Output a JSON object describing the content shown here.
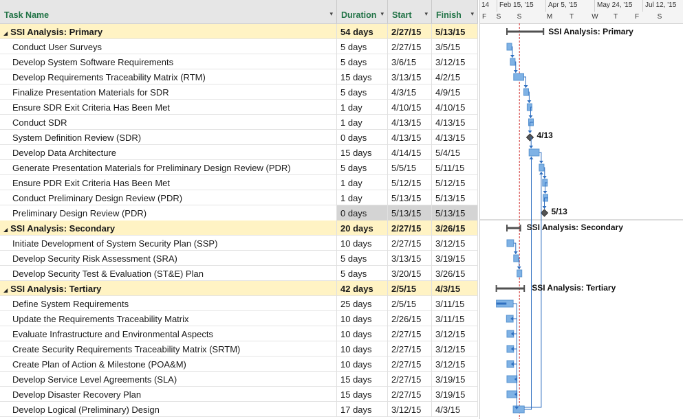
{
  "headers": {
    "task_name": "Task Name",
    "duration": "Duration",
    "start": "Start",
    "finish": "Finish"
  },
  "header_arrow": "▾",
  "summary_arrow": "◢",
  "timescale": {
    "top": [
      "14",
      "Feb 15, '15",
      "Apr 5, '15",
      "May 24, '15",
      "Jul 12, '15"
    ],
    "bottom": [
      "F",
      "S",
      "S",
      "M",
      "T",
      "W",
      "T",
      "F",
      "S"
    ]
  },
  "tasks": [
    {
      "name": "SSI Analysis: Primary",
      "duration": "54 days",
      "start": "2/27/15",
      "finish": "5/13/15",
      "summary": true
    },
    {
      "name": "Conduct User Surveys",
      "duration": "5 days",
      "start": "2/27/15",
      "finish": "3/5/15"
    },
    {
      "name": "Develop System Software Requirements",
      "duration": "5 days",
      "start": "3/6/15",
      "finish": "3/12/15"
    },
    {
      "name": "Develop Requirements Traceability Matrix (RTM)",
      "duration": "15 days",
      "start": "3/13/15",
      "finish": "4/2/15"
    },
    {
      "name": "Finalize Presentation Materials for SDR",
      "duration": "5 days",
      "start": "4/3/15",
      "finish": "4/9/15"
    },
    {
      "name": "Ensure SDR Exit Criteria Has Been Met",
      "duration": "1 day",
      "start": "4/10/15",
      "finish": "4/10/15"
    },
    {
      "name": "Conduct SDR",
      "duration": "1 day",
      "start": "4/13/15",
      "finish": "4/13/15"
    },
    {
      "name": "System Definition Review (SDR)",
      "duration": "0 days",
      "start": "4/13/15",
      "finish": "4/13/15"
    },
    {
      "name": "Develop Data Architecture",
      "duration": "15 days",
      "start": "4/14/15",
      "finish": "5/4/15"
    },
    {
      "name": "Generate Presentation Materials for Preliminary Design Review (PDR)",
      "duration": "5 days",
      "start": "5/5/15",
      "finish": "5/11/15"
    },
    {
      "name": "Ensure PDR Exit Criteria Has Been Met",
      "duration": "1 day",
      "start": "5/12/15",
      "finish": "5/12/15"
    },
    {
      "name": "Conduct Preliminary Design Review (PDR)",
      "duration": "1 day",
      "start": "5/13/15",
      "finish": "5/13/15"
    },
    {
      "name": "Preliminary Design Review (PDR)",
      "duration": "0 days",
      "start": "5/13/15",
      "finish": "5/13/15",
      "selected": true
    },
    {
      "name": "SSI Analysis: Secondary",
      "duration": "20 days",
      "start": "2/27/15",
      "finish": "3/26/15",
      "summary": true
    },
    {
      "name": "Initiate Development of System Security Plan (SSP)",
      "duration": "10 days",
      "start": "2/27/15",
      "finish": "3/12/15"
    },
    {
      "name": "Develop Security Risk Assessment (SRA)",
      "duration": "5 days",
      "start": "3/13/15",
      "finish": "3/19/15"
    },
    {
      "name": "Develop Security Test & Evaluation (ST&E) Plan",
      "duration": "5 days",
      "start": "3/20/15",
      "finish": "3/26/15"
    },
    {
      "name": "SSI Analysis: Tertiary",
      "duration": "42 days",
      "start": "2/5/15",
      "finish": "4/3/15",
      "summary": true
    },
    {
      "name": "Define System Requirements",
      "duration": "25 days",
      "start": "2/5/15",
      "finish": "3/11/15"
    },
    {
      "name": "Update the Requirements Traceability Matrix",
      "duration": "10 days",
      "start": "2/26/15",
      "finish": "3/11/15"
    },
    {
      "name": "Evaluate Infrastructure and Environmental Aspects",
      "duration": "10 days",
      "start": "2/27/15",
      "finish": "3/12/15"
    },
    {
      "name": "Create Security Requirements Traceability Matrix (SRTM)",
      "duration": "10 days",
      "start": "2/27/15",
      "finish": "3/12/15"
    },
    {
      "name": "Create Plan of Action & Milestone (POA&M)",
      "duration": "10 days",
      "start": "2/27/15",
      "finish": "3/12/15"
    },
    {
      "name": "Develop Service Level Agreements (SLA)",
      "duration": "15 days",
      "start": "2/27/15",
      "finish": "3/19/15"
    },
    {
      "name": "Develop Disaster Recovery Plan",
      "duration": "15 days",
      "start": "2/27/15",
      "finish": "3/19/15"
    },
    {
      "name": "Develop Logical (Preliminary) Design",
      "duration": "17 days",
      "start": "3/12/15",
      "finish": "4/3/15"
    }
  ],
  "gantt_labels": {
    "primary": "SSI Analysis: Primary",
    "sdr_milestone": "4/13",
    "pdr_milestone": "5/13",
    "secondary": "SSI Analysis: Secondary",
    "tertiary": "SSI Analysis: Tertiary"
  },
  "colors": {
    "bar": "#7fb2e5",
    "bar_border": "#5a94d0",
    "summary": "#505050",
    "link": "#2f6fc0",
    "status_line": "#d03030",
    "header_text": "#217346",
    "summary_row": "#fff3c4"
  }
}
